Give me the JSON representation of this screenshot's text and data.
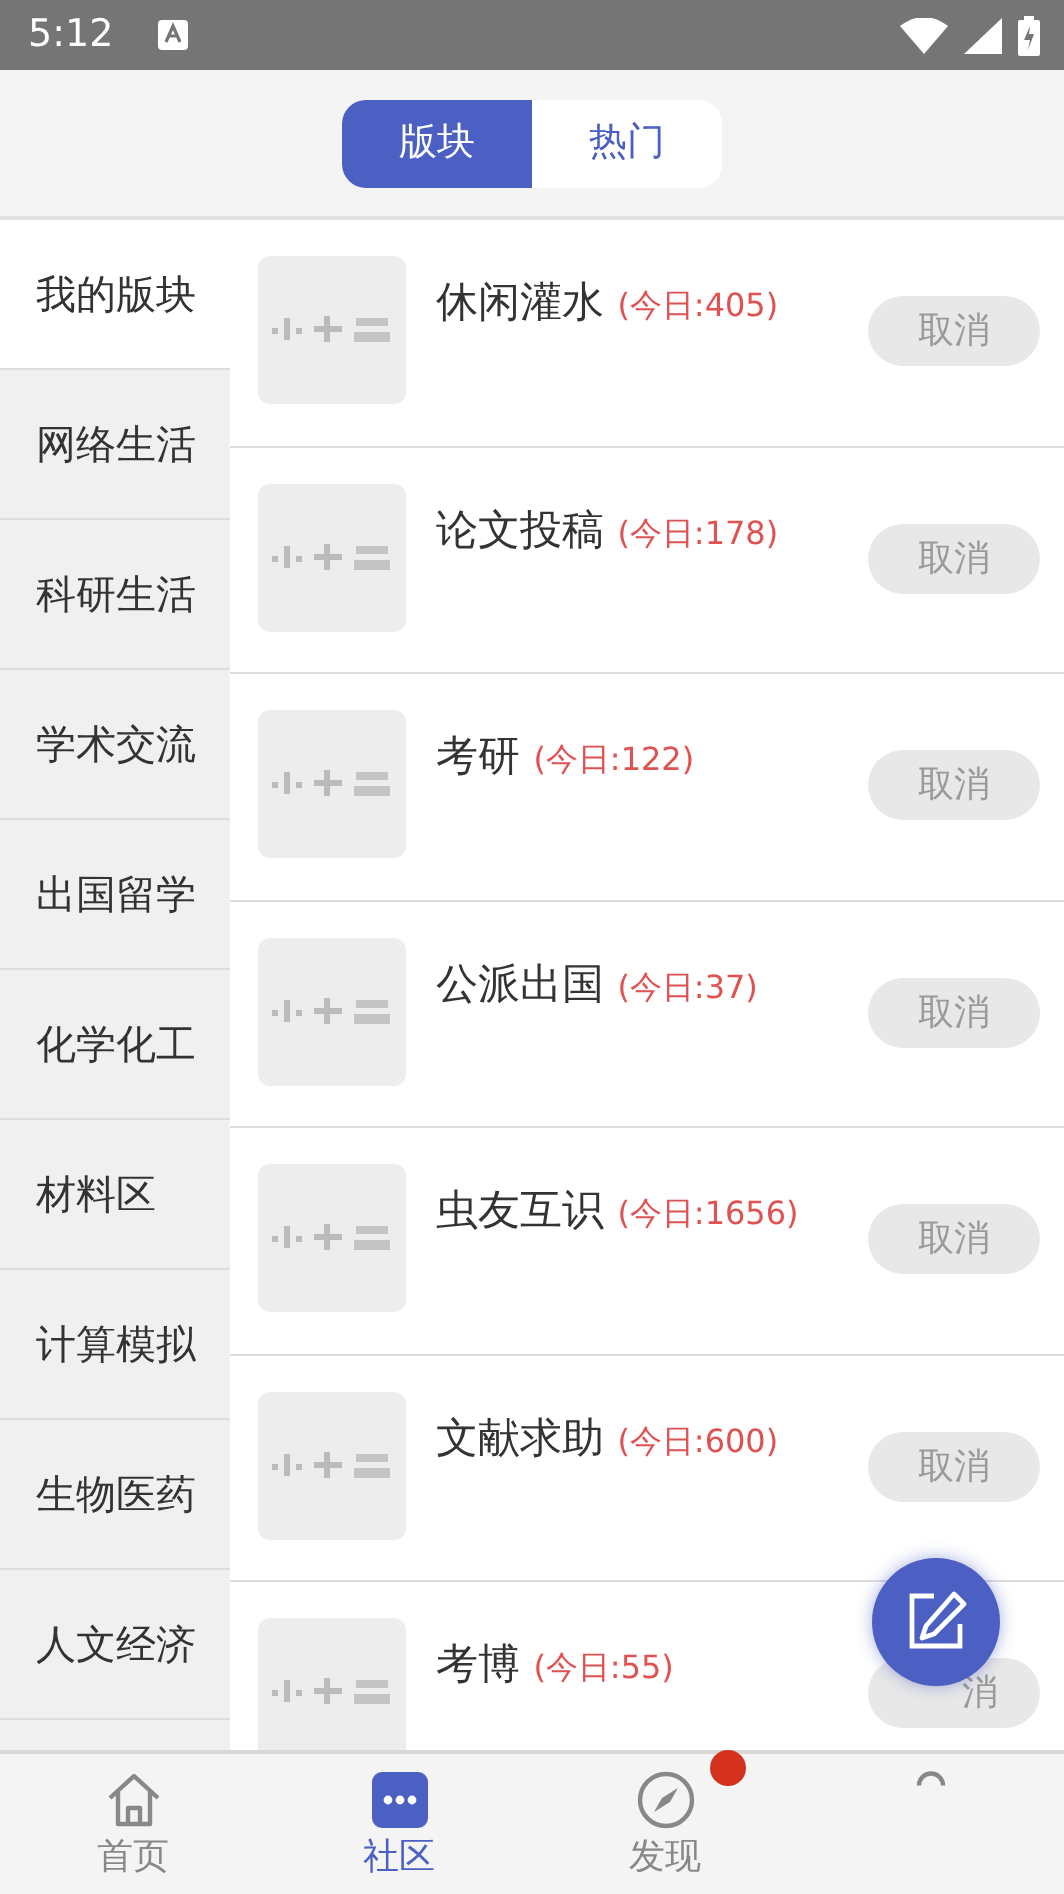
{
  "status_bar": {
    "time": "5:12"
  },
  "segments": [
    {
      "label": "版块",
      "selected": true
    },
    {
      "label": "热门",
      "selected": false
    }
  ],
  "sidebar": {
    "items": [
      {
        "label": "我的版块",
        "selected": true
      },
      {
        "label": "网络生活",
        "selected": false
      },
      {
        "label": "科研生活",
        "selected": false
      },
      {
        "label": "学术交流",
        "selected": false
      },
      {
        "label": "出国留学",
        "selected": false
      },
      {
        "label": "化学化工",
        "selected": false
      },
      {
        "label": "材料区",
        "selected": false
      },
      {
        "label": "计算模拟",
        "selected": false
      },
      {
        "label": "生物医药",
        "selected": false
      },
      {
        "label": "人文经济",
        "selected": false
      }
    ]
  },
  "forums": [
    {
      "name": "休闲灌水",
      "today": "(今日:405)",
      "button": "取消"
    },
    {
      "name": "论文投稿",
      "today": "(今日:178)",
      "button": "取消"
    },
    {
      "name": "考研",
      "today": "(今日:122)",
      "button": "取消"
    },
    {
      "name": "公派出国",
      "today": "(今日:37)",
      "button": "取消"
    },
    {
      "name": "虫友互识",
      "today": "(今日:1656)",
      "button": "取消"
    },
    {
      "name": "文献求助",
      "today": "(今日:600)",
      "button": "取消"
    },
    {
      "name": "考博",
      "today": "(今日:55)",
      "button": "消"
    }
  ],
  "bottom_nav": [
    {
      "kind": "home",
      "label": "首页",
      "selected": false,
      "dot": false
    },
    {
      "kind": "community",
      "label": "社区",
      "selected": true,
      "dot": false
    },
    {
      "kind": "discover",
      "label": "发现",
      "selected": false,
      "dot": true
    },
    {
      "kind": "profile",
      "selected": false,
      "dot": false
    }
  ]
}
